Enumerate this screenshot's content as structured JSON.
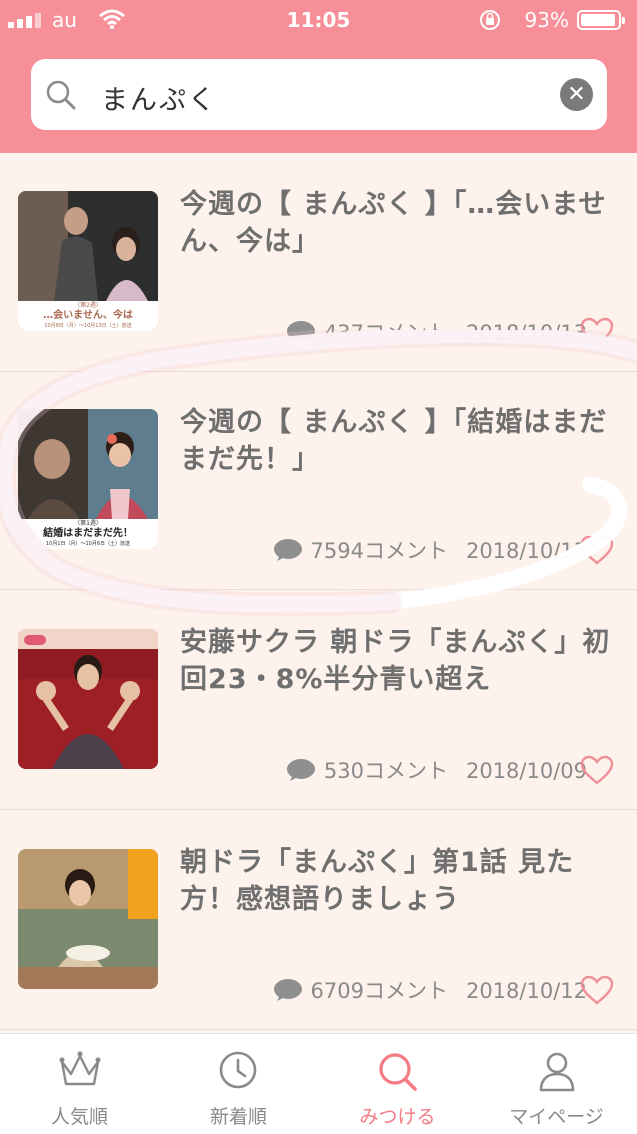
{
  "status_bar": {
    "carrier": "au",
    "time": "11:05",
    "battery": "93%"
  },
  "search": {
    "query": "まんぷく"
  },
  "articles": [
    {
      "title": "今週の【 まんぷく 】「…会いません、今は」",
      "thumb_caption": "…会いません、今は",
      "comments": "437コメント",
      "date": "2018/10/13"
    },
    {
      "title": "今週の【 まんぷく 】「結婚はまだまだ先！」",
      "thumb_caption": "結婚はまだまだ先！",
      "comments": "7594コメント",
      "date": "2018/10/13"
    },
    {
      "title": "安藤サクラ 朝ドラ「まんぷく」初回23・8%半分青い超え",
      "comments": "530コメント",
      "date": "2018/10/09"
    },
    {
      "title": "朝ドラ「まんぷく」第1話 見た方！感想語りましょう",
      "comments": "6709コメント",
      "date": "2018/10/12"
    }
  ],
  "tabs": [
    {
      "label": "人気順",
      "icon": "crown-icon",
      "active": false
    },
    {
      "label": "新着順",
      "icon": "clock-icon",
      "active": false
    },
    {
      "label": "みつける",
      "icon": "search-icon",
      "active": true
    },
    {
      "label": "マイページ",
      "icon": "person-icon",
      "active": false
    }
  ],
  "colors": {
    "header": "#f78f98",
    "background": "#fdf3ec",
    "accent": "#f47a85"
  }
}
